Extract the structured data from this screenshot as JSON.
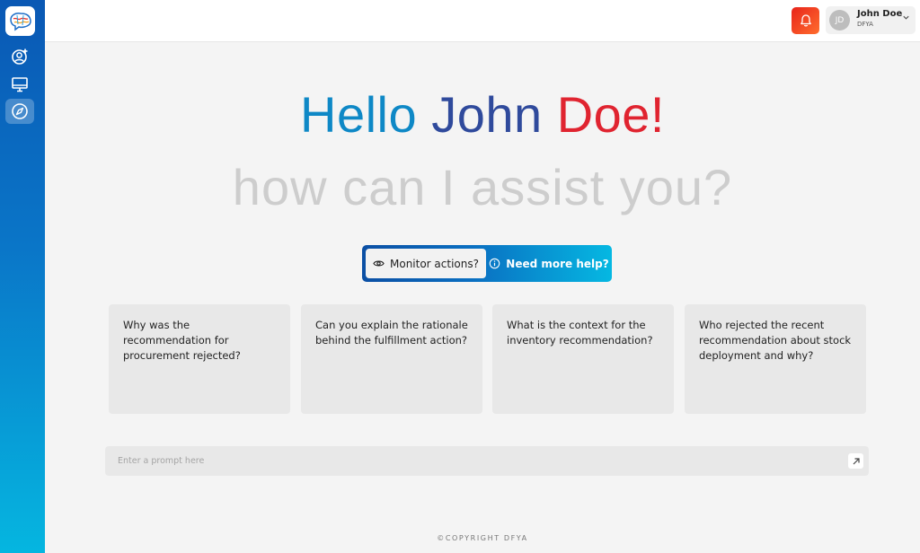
{
  "header": {
    "user": {
      "initials": "JD",
      "name": "John Doe",
      "org": "DFYA"
    }
  },
  "greeting": {
    "word1": "Hello",
    "word2": "John",
    "word3": "Doe!",
    "subtitle": "how can I assist you?"
  },
  "toggle": {
    "active_label": "Monitor actions?",
    "other_label": "Need more help?"
  },
  "suggestions": [
    {
      "text": "Why was the recommendation for procurement rejected?"
    },
    {
      "text": "Can you explain the rationale behind the fulfillment action?"
    },
    {
      "text": "What is the context for the inventory recommendation?"
    },
    {
      "text": "Who rejected the recent recommendation about stock deployment and why?"
    }
  ],
  "prompt": {
    "placeholder": "Enter a prompt here",
    "value": ""
  },
  "footer": {
    "copyright": "©COPYRIGHT DFYA"
  },
  "colors": {
    "sidebar_top": "#0a58b4",
    "sidebar_bottom": "#05b6e0",
    "hello": "#0e88c6",
    "john": "#2f4a9c",
    "doe": "#e02430",
    "notification": "#f24a20"
  },
  "icons": {
    "logo": "brain-logo-icon",
    "nav": [
      "user-add-icon",
      "monitor-icon",
      "compass-icon"
    ],
    "notification": "bell-icon",
    "user_menu": "chevron-down-icon",
    "monitor": "eye-icon",
    "help": "info-icon",
    "send": "arrow-up-right-icon"
  }
}
